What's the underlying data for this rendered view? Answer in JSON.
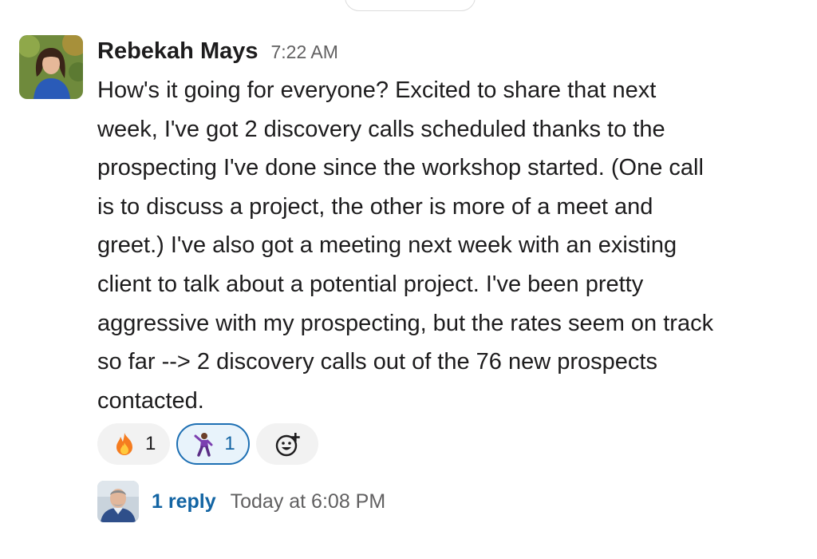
{
  "message": {
    "author": "Rebekah Mays",
    "time": "7:22 AM",
    "text": "How's it going for everyone? Excited to share that next\nweek, I've got 2 discovery calls scheduled thanks to the\nprospecting I've done since the workshop started. (One call\nis to discuss a project, the other is more of a meet and\ngreet.) I've also got a meeting next week with an existing\nclient to talk about a potential project. I've been pretty\naggressive with my prospecting, but the rates seem on track\nso far --> 2 discovery calls out of the 76 new prospects\ncontacted."
  },
  "reactions": [
    {
      "emoji": "fire-emoji",
      "count": "1",
      "selected": false
    },
    {
      "emoji": "dancer-emoji",
      "count": "1",
      "selected": true
    }
  ],
  "add_reaction_icon": "add-reaction-icon",
  "thread": {
    "reply_label": "1 reply",
    "last_reply": "Today at 6:08 PM"
  },
  "colors": {
    "link": "#1264a3",
    "selected_border": "#1d6fb3",
    "selected_bg": "#e8f3fb",
    "muted": "#616061"
  }
}
